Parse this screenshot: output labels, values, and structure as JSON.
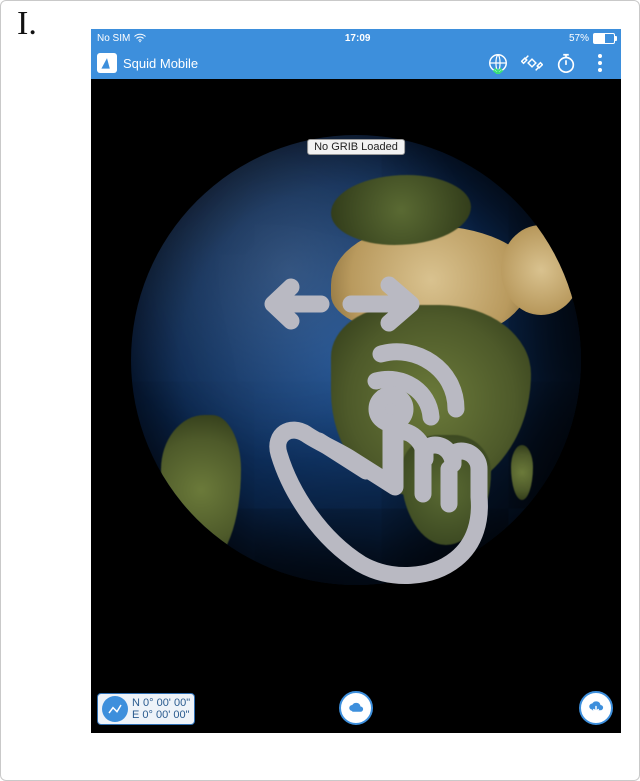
{
  "step_label": "I.",
  "status_bar": {
    "sim": "No SIM",
    "time": "17:09",
    "battery_pct": "57%",
    "battery_fill_pct": 57
  },
  "header": {
    "app_title": "Squid Mobile"
  },
  "map": {
    "grib_status": "No GRIB Loaded"
  },
  "footer": {
    "lat": "N 0° 00' 00\"",
    "lon": "E 0° 00' 00\""
  },
  "colors": {
    "accent": "#3d8fdc"
  }
}
